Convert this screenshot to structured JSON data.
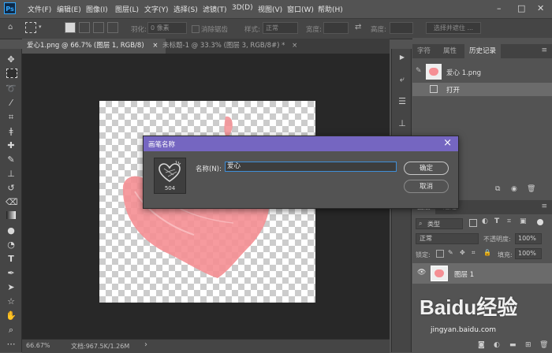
{
  "menu": {
    "logo": "Ps",
    "items": [
      "文件(F)",
      "编辑(E)",
      "图像(I)",
      "图层(L)",
      "文字(Y)",
      "选择(S)",
      "滤镜(T)",
      "3D(D)",
      "视图(V)",
      "窗口(W)",
      "帮助(H)"
    ]
  },
  "options": {
    "feather_label": "羽化:",
    "feather_value": "0 像素",
    "antialias_label": "消除锯齿",
    "style_label": "样式:",
    "style_value": "正常",
    "width_label": "宽度:",
    "height_label": "高度:",
    "select_mask_label": "选择并遮住 ..."
  },
  "tabs": [
    {
      "label": "爱心1.png @ 66.7% (图层 1, RGB/8)",
      "close": "×"
    },
    {
      "label": "未标题-1 @ 33.3% (图层 3, RGB/8#) *",
      "close": "×"
    }
  ],
  "status": {
    "zoom": "66.67%",
    "doc_info": "文档:967.5K/1.26M",
    "arrow": "›"
  },
  "history_panel": {
    "tabs": [
      "字符",
      "属性",
      "历史记录"
    ],
    "snapshot_label": "爱心 1.png",
    "step_label": "打开"
  },
  "layers_panel": {
    "tabs": [
      "图层",
      "通道"
    ],
    "filter_kind": "类型",
    "blend_mode": "正常",
    "opacity_label": "不透明度:",
    "opacity_value": "100%",
    "lock_label": "锁定:",
    "fill_label": "填充:",
    "fill_value": "100%",
    "layer_name": "图层 1"
  },
  "dialog": {
    "title": "画笔名称",
    "preview_number": "504",
    "name_label": "名称(N):",
    "name_value": "爱心",
    "ok_label": "确定",
    "cancel_label": "取消",
    "close_glyph": "×"
  },
  "watermark": {
    "brand": "Baidu经验",
    "url": "jingyan.baidu.com"
  },
  "colors": {
    "dialog_title_bar": "#7566c1",
    "heart_pink": "#f58f94",
    "focus_border": "#3f8fd8"
  }
}
